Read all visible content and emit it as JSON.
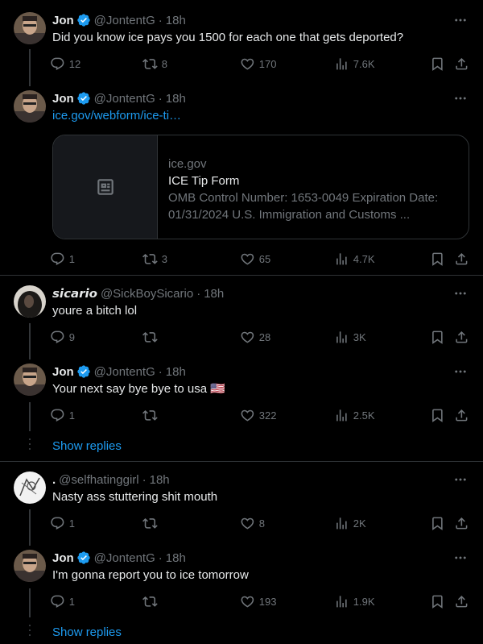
{
  "tweets": [
    {
      "name": "Jon",
      "handle": "@JontentG",
      "time": "18h",
      "verified": true,
      "text": "Did you know ice pays you 1500 for each one that gets deported?",
      "replies": "12",
      "retweets": "8",
      "likes": "170",
      "views": "7.6K"
    },
    {
      "name": "Jon",
      "handle": "@JontentG",
      "time": "18h",
      "verified": true,
      "text": "ice.gov/webform/ice-ti…",
      "card": {
        "domain": "ice.gov",
        "title": "ICE Tip Form",
        "description": "OMB Control Number: 1653-0049 Expiration Date: 01/31/2024 U.S. Immigration and Customs ..."
      },
      "replies": "1",
      "retweets": "3",
      "likes": "65",
      "views": "4.7K"
    },
    {
      "name": "𝙨𝙞𝙘𝙖𝙧𝙞𝙤",
      "handle": "@SickBoySicario",
      "time": "18h",
      "verified": false,
      "text": "youre a bitch lol",
      "replies": "9",
      "retweets": "",
      "likes": "28",
      "views": "3K"
    },
    {
      "name": "Jon",
      "handle": "@JontentG",
      "time": "18h",
      "verified": true,
      "text": "Your next say bye bye to usa 🇺🇸",
      "replies": "1",
      "retweets": "",
      "likes": "322",
      "views": "2.5K"
    },
    {
      "name": ".",
      "handle": "@selfhatinggirl",
      "time": "18h",
      "verified": false,
      "text": "Nasty ass stuttering shit mouth",
      "replies": "1",
      "retweets": "",
      "likes": "8",
      "views": "2K"
    },
    {
      "name": "Jon",
      "handle": "@JontentG",
      "time": "18h",
      "verified": true,
      "text": "I'm gonna report you to ice tomorrow",
      "replies": "1",
      "retweets": "",
      "likes": "193",
      "views": "1.9K"
    }
  ],
  "show_replies_label": "Show replies",
  "colors": {
    "background": "#000000",
    "accent": "#1d9bf0",
    "muted": "#71767b",
    "text": "#e7e9ea",
    "divider": "#2f3336"
  },
  "icons": [
    "reply-icon",
    "retweet-icon",
    "like-icon",
    "views-icon",
    "bookmark-icon",
    "share-icon",
    "more-icon",
    "verified-badge-icon",
    "article-icon"
  ]
}
